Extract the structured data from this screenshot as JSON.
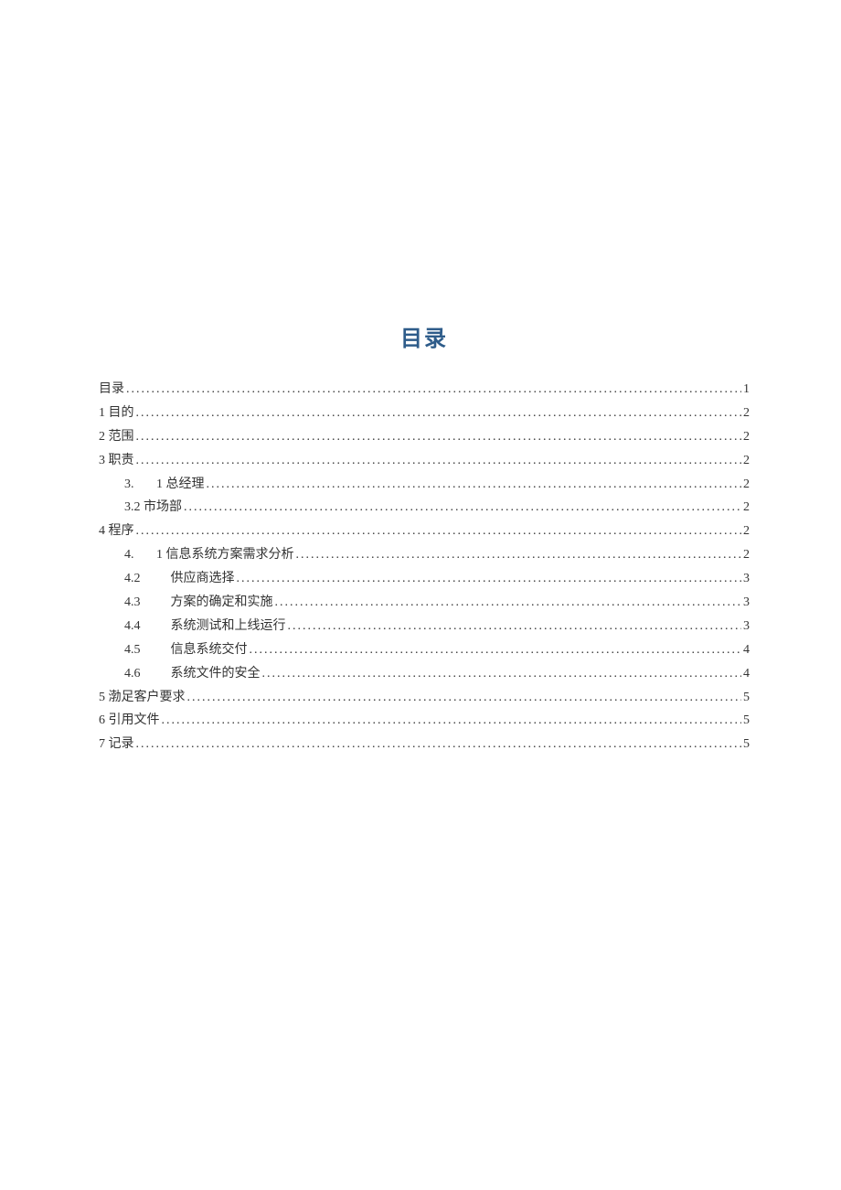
{
  "title": "目录",
  "toc": [
    {
      "indent": 0,
      "num": "",
      "text": "目录",
      "page": "1"
    },
    {
      "indent": 0,
      "num": "",
      "text": "1 目的",
      "page": "2"
    },
    {
      "indent": 0,
      "num": "",
      "text": "2 范围",
      "page": "2"
    },
    {
      "indent": 0,
      "num": "",
      "text": "3 职责",
      "page": "2"
    },
    {
      "indent": 1,
      "num": "3.",
      "text": "1 总经理",
      "page": "2"
    },
    {
      "indent": 1,
      "num": "",
      "text": "3.2 市场部",
      "page": "2"
    },
    {
      "indent": 0,
      "num": "",
      "text": "4 程序",
      "page": "2"
    },
    {
      "indent": 1,
      "num": "4.",
      "text": "1 信息系统方案需求分析",
      "page": "2"
    },
    {
      "indent": 1,
      "num": "4.2",
      "text": "供应商选择",
      "page": "3"
    },
    {
      "indent": 1,
      "num": "4.3",
      "text": "方案的确定和实施",
      "page": "3"
    },
    {
      "indent": 1,
      "num": "4.4",
      "text": "系统测试和上线运行",
      "page": "3"
    },
    {
      "indent": 1,
      "num": "4.5",
      "text": "信息系统交付",
      "page": "4"
    },
    {
      "indent": 1,
      "num": "4.6",
      "text": "系统文件的安全",
      "page": "4"
    },
    {
      "indent": 0,
      "num": "",
      "text": "5 渤足客户要求",
      "page": "5"
    },
    {
      "indent": 0,
      "num": "",
      "text": "6 引用文件",
      "page": "5"
    },
    {
      "indent": 0,
      "num": "",
      "text": "7 记录",
      "page": "5"
    }
  ]
}
